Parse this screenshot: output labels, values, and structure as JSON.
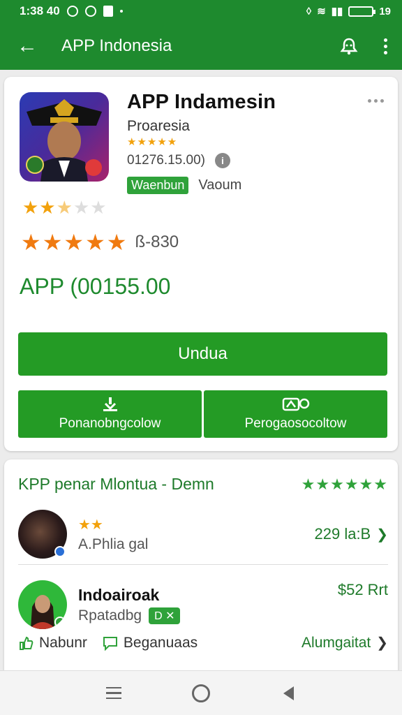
{
  "status_bar": {
    "time": "1:38 40",
    "right_text": "19"
  },
  "app_bar": {
    "title": "APP Indonesia"
  },
  "app_card": {
    "name": "APP Indamesin",
    "publisher": "Proaresia",
    "small_stars": "★★★★★",
    "meta": "01276.15.00)",
    "badge": "Waenbun",
    "tag": "Vaoum",
    "rating_stars_on": "★★",
    "rating_stars_half": "★",
    "rating_stars_off": "★★",
    "big_stars": "★★★★★",
    "review_count": "ß-830",
    "price": "APP (00155.00",
    "install_label": "Undua",
    "button_left_label": "Ponanobngcolow",
    "button_right_label": "Perogaosocoltow"
  },
  "list_card": {
    "title": "KPP penar Mlontua - Demn",
    "header_stars": "★★★★★★",
    "items": [
      {
        "stars": "★★",
        "subtitle": "A.Phlia gal",
        "right": "229 la:B"
      },
      {
        "name": "Indoairoak",
        "subtitle": "Rpatadbg",
        "badge": "D ✕",
        "right": "$52 Rrt"
      }
    ],
    "actions": {
      "like": "Nabunr",
      "comment": "Beganuaas",
      "link": "Alumgaitat"
    }
  },
  "colors": {
    "brand_green": "#1e8a2e",
    "button_green": "#249b25",
    "star_orange": "#f2a10c"
  },
  "icons": [
    "back-arrow-icon",
    "bell-icon",
    "more-vert-icon",
    "info-icon",
    "overflow-icon",
    "download-icon",
    "cart-icon",
    "chevron-right-icon",
    "thumbs-up-icon",
    "comment-icon",
    "menu-icon",
    "home-icon",
    "back-nav-icon"
  ]
}
